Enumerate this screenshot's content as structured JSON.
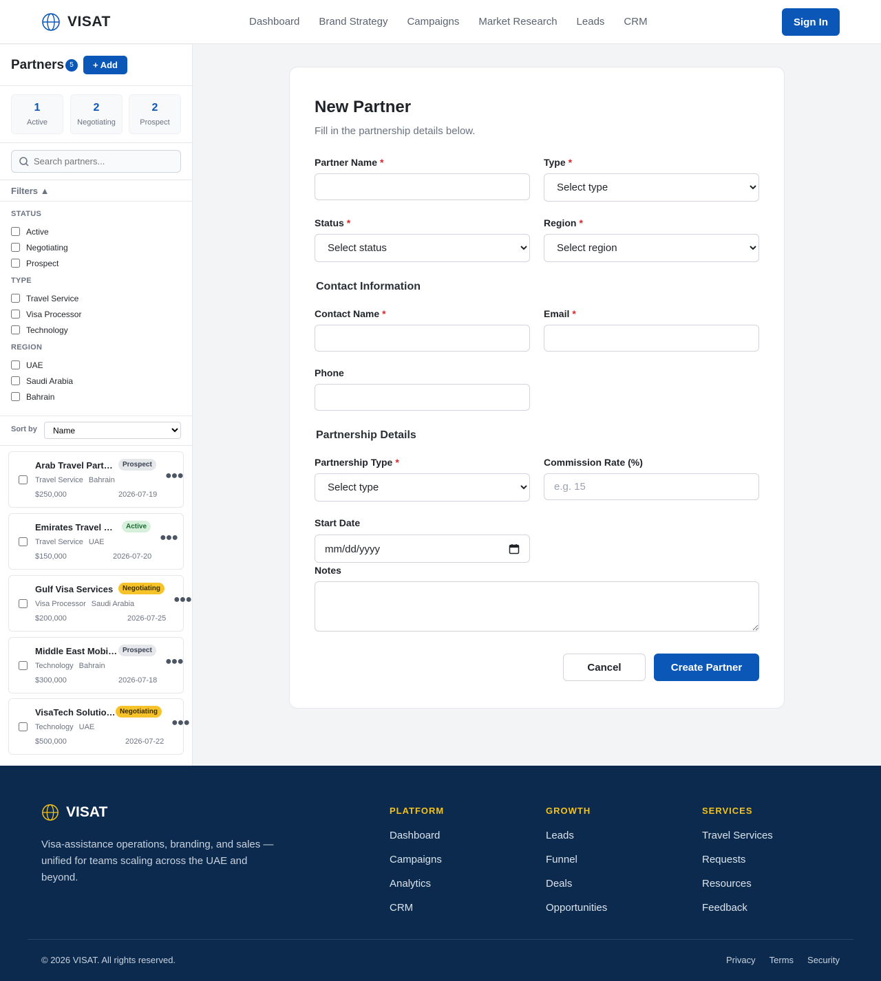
{
  "header": {
    "brand": "VISAT",
    "nav": [
      "Dashboard",
      "Brand Strategy",
      "Campaigns",
      "Market Research",
      "Leads",
      "CRM"
    ],
    "sign_in": "Sign In"
  },
  "sidebar": {
    "title": "Partners",
    "count": "5",
    "add_label": "+ Add",
    "stats": [
      {
        "value": "1",
        "label": "Active"
      },
      {
        "value": "2",
        "label": "Negotiating"
      },
      {
        "value": "2",
        "label": "Prospect"
      }
    ],
    "search_placeholder": "Search partners...",
    "filters_label": "Filters ▲",
    "filter_groups": [
      {
        "title": "STATUS",
        "options": [
          "Active",
          "Negotiating",
          "Prospect"
        ]
      },
      {
        "title": "TYPE",
        "options": [
          "Travel Service",
          "Visa Processor",
          "Technology"
        ]
      },
      {
        "title": "REGION",
        "options": [
          "UAE",
          "Saudi Arabia",
          "Bahrain"
        ]
      }
    ],
    "sort_label": "Sort by",
    "sort_value": "Name",
    "partners": [
      {
        "name": "Arab Travel Partners",
        "status": "Prospect",
        "type": "Travel Service",
        "region": "Bahrain",
        "value": "$250,000",
        "date": "2026-07-19"
      },
      {
        "name": "Emirates Travel Services",
        "status": "Active",
        "type": "Travel Service",
        "region": "UAE",
        "value": "$150,000",
        "date": "2026-07-20"
      },
      {
        "name": "Gulf Visa Services",
        "status": "Negotiating",
        "type": "Visa Processor",
        "region": "Saudi Arabia",
        "value": "$200,000",
        "date": "2026-07-25"
      },
      {
        "name": "Middle East Mobility",
        "status": "Prospect",
        "type": "Technology",
        "region": "Bahrain",
        "value": "$300,000",
        "date": "2026-07-18"
      },
      {
        "name": "VisaTech Solutions",
        "status": "Negotiating",
        "type": "Technology",
        "region": "UAE",
        "value": "$500,000",
        "date": "2026-07-22"
      }
    ]
  },
  "form": {
    "title": "New Partner",
    "subtitle": "Fill in the partnership details below.",
    "partner_name_label": "Partner Name",
    "type_label": "Type",
    "type_value": "Select type",
    "status_label": "Status",
    "status_value": "Select status",
    "region_label": "Region",
    "region_value": "Select region",
    "contact_section": "Contact Information",
    "contact_name_label": "Contact Name",
    "email_label": "Email",
    "phone_label": "Phone",
    "partnership_section": "Partnership Details",
    "partnership_type_label": "Partnership Type",
    "partnership_type_value": "Select type",
    "commission_label": "Commission Rate (%)",
    "commission_placeholder": "e.g. 15",
    "start_date_label": "Start Date",
    "start_date_value": "mm/dd/yyyy",
    "notes_label": "Notes",
    "required_mark": "*",
    "cancel_label": "Cancel",
    "create_label": "Create Partner"
  },
  "footer": {
    "brand": "VISAT",
    "description": "Visa-assistance operations, branding, and sales — unified for teams scaling across the UAE and beyond.",
    "columns": [
      {
        "title": "PLATFORM",
        "links": [
          "Dashboard",
          "Campaigns",
          "Analytics",
          "CRM"
        ]
      },
      {
        "title": "GROWTH",
        "links": [
          "Leads",
          "Funnel",
          "Deals",
          "Opportunities"
        ]
      },
      {
        "title": "SERVICES",
        "links": [
          "Travel Services",
          "Requests",
          "Resources",
          "Feedback"
        ]
      }
    ],
    "copyright": "© 2026 VISAT. All rights reserved.",
    "legal": [
      "Privacy",
      "Terms",
      "Security"
    ]
  },
  "colors": {
    "primary": "#0b57b8",
    "footer_bg": "#0b2a4e",
    "accent_gold": "#f4c21a",
    "required": "#d92626"
  },
  "icons": [
    "globe-icon",
    "search-icon",
    "calendar-icon",
    "more-icon"
  ]
}
